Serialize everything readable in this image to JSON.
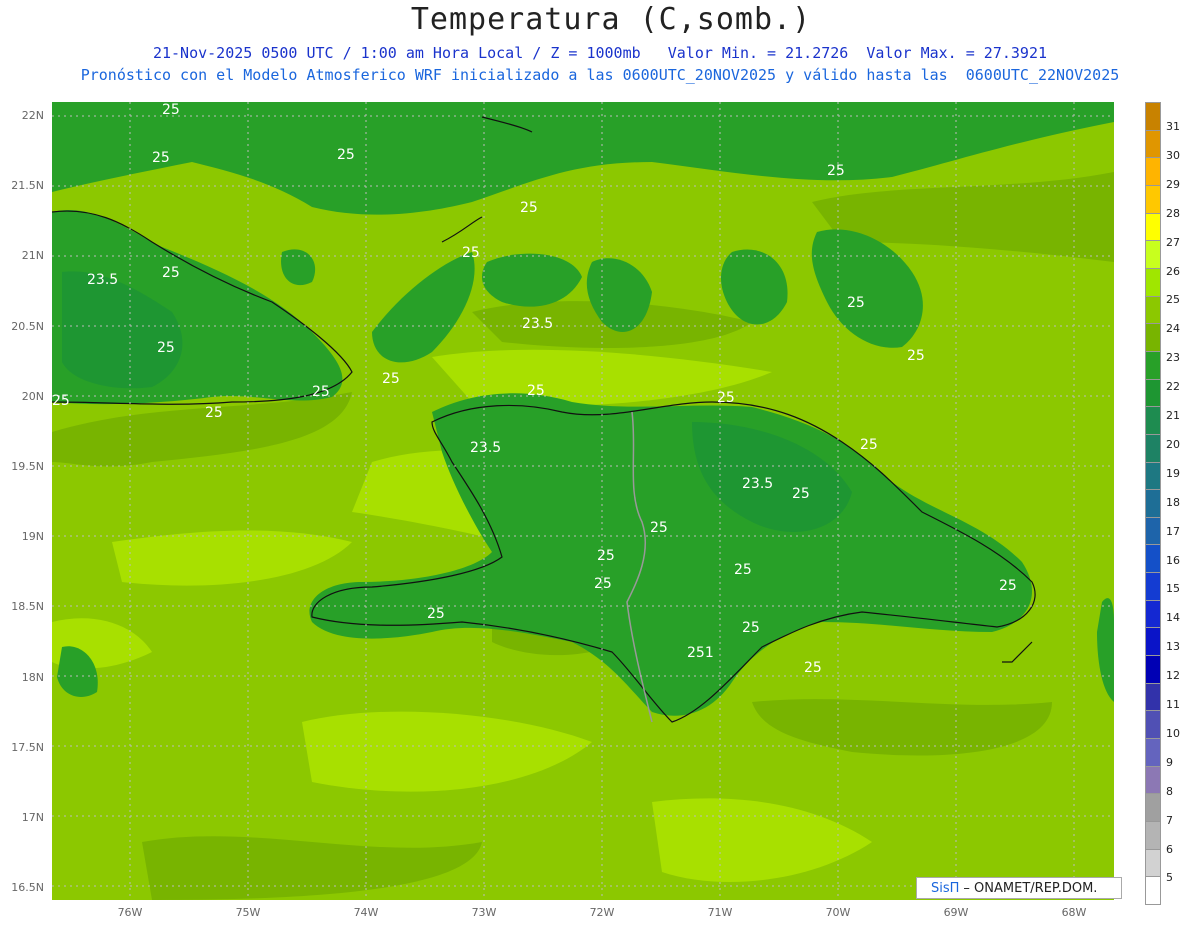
{
  "header": {
    "title": "Temperatura (C,somb.)",
    "subtitle1": "21-Nov-2025 0500 UTC / 1:00 am Hora Local / Z = 1000mb   Valor Min. = 21.2726  Valor Max. = 27.3921",
    "subtitle2": "Pronóstico con el Modelo Atmosferico WRF inicializado a las 0600UTC_20NOV2025 y válido hasta las  0600UTC_22NOV2025"
  },
  "axes": {
    "lat_labels": [
      "22N",
      "21.5N",
      "21N",
      "20.5N",
      "20N",
      "19.5N",
      "19N",
      "18.5N",
      "18N",
      "17.5N",
      "17N",
      "16.5N"
    ],
    "lon_labels": [
      "76W",
      "75W",
      "74W",
      "73W",
      "72W",
      "71W",
      "70W",
      "69W",
      "68W"
    ]
  },
  "contour_labels": [
    "25",
    "25",
    "25",
    "25",
    "25",
    "25",
    "23.5",
    "25",
    "23.5",
    "25",
    "25",
    "25",
    "25",
    "25",
    "25",
    "25",
    "25",
    "25",
    "23.5",
    "23.5",
    "25",
    "25",
    "25",
    "25",
    "25",
    "25",
    "25",
    "251",
    "25",
    "25",
    "25",
    "25",
    "25"
  ],
  "colorbar": {
    "labels": [
      "31",
      "30",
      "29",
      "28",
      "27",
      "26",
      "25",
      "24",
      "23",
      "22",
      "21",
      "20",
      "19",
      "18",
      "17",
      "16",
      "15",
      "14",
      "13",
      "12",
      "11",
      "10",
      "9",
      "8",
      "7",
      "6",
      "5"
    ],
    "colors": [
      "#c88200",
      "#e09600",
      "#ffb400",
      "#ffc800",
      "#ffff00",
      "#c8ff1e",
      "#a0e600",
      "#8cc800",
      "#78b400",
      "#28a028",
      "#1e9632",
      "#1e8c50",
      "#1e8264",
      "#1e7882",
      "#1e6e96",
      "#1e64aa",
      "#1450c8",
      "#143cd2",
      "#1428d2",
      "#0a14c8",
      "#0000b4",
      "#3232aa",
      "#5050b4",
      "#6464be",
      "#8c78b4",
      "#a0a0a0",
      "#b4b4b4",
      "#d2d2d2",
      "#ffffff"
    ]
  },
  "credit": {
    "brand": "SisΠ",
    "text": "– ONAMET/REP.DOM."
  }
}
